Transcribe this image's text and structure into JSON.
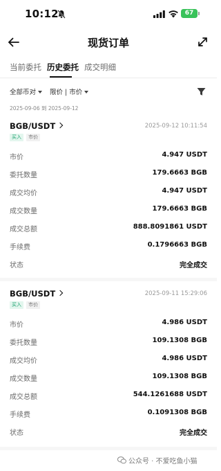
{
  "status_bar": {
    "time": "10:12",
    "battery": "67"
  },
  "nav": {
    "title": "现货订单"
  },
  "tabs": [
    {
      "label": "当前委托",
      "active": false
    },
    {
      "label": "历史委托",
      "active": true
    },
    {
      "label": "成交明细",
      "active": false
    }
  ],
  "filters": {
    "market": "全部币对",
    "type": "限价 | 市价"
  },
  "date_range": "2025-09-06  到  2025-09-12",
  "orders": [
    {
      "pair": "BGB/USDT",
      "time": "2025-09-12 10:11:54",
      "side": "买入",
      "order_type": "市价",
      "rows": [
        {
          "label": "市价",
          "value": "4.947 USDT"
        },
        {
          "label": "委托数量",
          "value": "179.6663 BGB"
        },
        {
          "label": "成交均价",
          "value": "4.947 USDT"
        },
        {
          "label": "成交数量",
          "value": "179.6663 BGB"
        },
        {
          "label": "成交总额",
          "value": "888.8091861 USDT"
        },
        {
          "label": "手续费",
          "value": "0.1796663 BGB"
        },
        {
          "label": "状态",
          "value": "完全成交"
        }
      ]
    },
    {
      "pair": "BGB/USDT",
      "time": "2025-09-11 15:29:06",
      "side": "买入",
      "order_type": "市价",
      "rows": [
        {
          "label": "市价",
          "value": "4.986 USDT"
        },
        {
          "label": "委托数量",
          "value": "109.1308 BGB"
        },
        {
          "label": "成交均价",
          "value": "4.986 USDT"
        },
        {
          "label": "成交数量",
          "value": "109.1308 BGB"
        },
        {
          "label": "成交总额",
          "value": "544.1261688 USDT"
        },
        {
          "label": "手续费",
          "value": "0.1091308 BGB"
        },
        {
          "label": "状态",
          "value": "完全成交"
        }
      ]
    }
  ],
  "watermark": "公众号 · 不爱吃鱼小猫",
  "colors": {
    "buy_badge_bg": "#e3f6ee",
    "buy_badge_text": "#1fa371",
    "battery": "#39c25a"
  },
  "icons": [
    "bell-slash-icon",
    "signal-icon",
    "wifi-icon",
    "battery-icon",
    "back-arrow-icon",
    "sort-icon",
    "filter-icon",
    "chevron-right-icon",
    "wechat-icon"
  ]
}
